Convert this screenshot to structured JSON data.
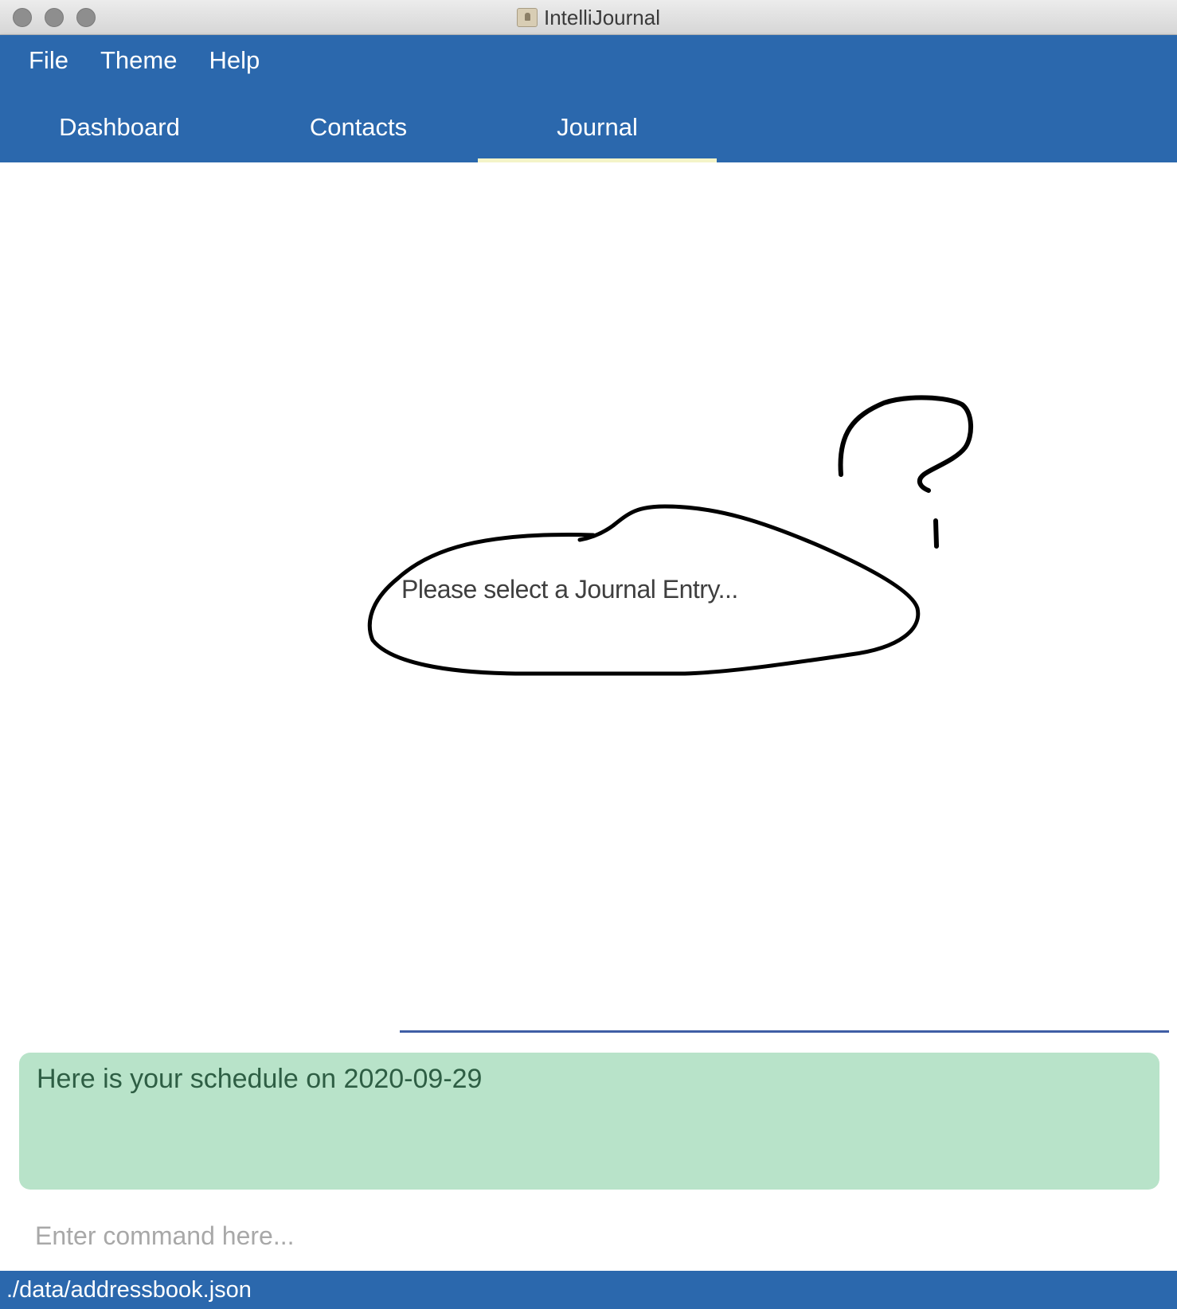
{
  "window": {
    "title": "IntelliJournal"
  },
  "menu": {
    "items": [
      "File",
      "Theme",
      "Help"
    ]
  },
  "tabs": [
    {
      "label": "Dashboard",
      "active": false
    },
    {
      "label": "Contacts",
      "active": false
    },
    {
      "label": "Journal",
      "active": true
    }
  ],
  "main": {
    "placeholder": "Please select a Journal Entry..."
  },
  "result": {
    "text": "Here is your schedule on 2020-09-29"
  },
  "command": {
    "placeholder": "Enter command here...",
    "value": ""
  },
  "status": {
    "file_path": "./data/addressbook.json"
  },
  "colors": {
    "header": "#2b68ad",
    "active_tab_underline": "#f4f4c8",
    "result_background": "#b8e3c9",
    "divider": "#3f5ea5"
  }
}
